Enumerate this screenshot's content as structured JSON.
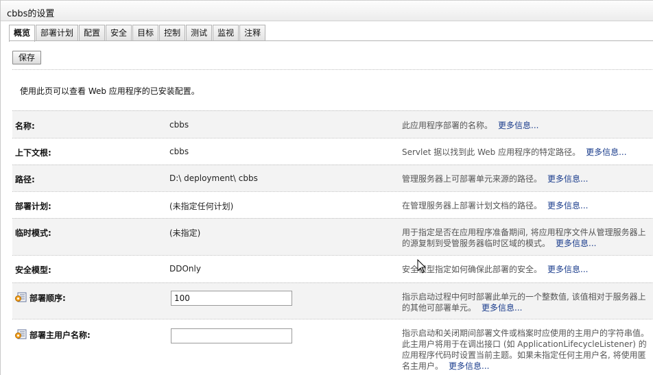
{
  "window": {
    "title": "cbbs的设置"
  },
  "tabs": [
    {
      "label": "概览",
      "active": true
    },
    {
      "label": "部署计划"
    },
    {
      "label": "配置"
    },
    {
      "label": "安全"
    },
    {
      "label": "目标"
    },
    {
      "label": "控制"
    },
    {
      "label": "测试"
    },
    {
      "label": "监视"
    },
    {
      "label": "注释"
    }
  ],
  "toolbar": {
    "save_label": "保存"
  },
  "intro": "使用此页可以查看 Web 应用程序的已安装配置。",
  "more_info": "更多信息...",
  "rows": [
    {
      "label": "名称:",
      "value": "cbbs",
      "desc": "此应用程序部署的名称。"
    },
    {
      "label": "上下文根:",
      "value": "cbbs",
      "desc": "Servlet 据以找到此 Web 应用程序的特定路径。"
    },
    {
      "label": "路径:",
      "value": "D:\\ deployment\\ cbbs",
      "desc": "管理服务器上可部署单元来源的路径。"
    },
    {
      "label": "部署计划:",
      "value": "(未指定任何计划)",
      "desc": "在管理服务器上部署计划文档的路径。"
    },
    {
      "label": "临时模式:",
      "value": "(未指定)",
      "desc": "用于指定是否在应用程序准备期间, 将应用程序文件从管理服务器上的源复制到受管服务器临时区域的模式。"
    },
    {
      "label": "安全模型:",
      "value": "DDOnly",
      "desc": "安全模型指定如何确保此部署的安全。"
    },
    {
      "label": "部署顺序:",
      "value": "100",
      "desc": "指示启动过程中何时部署此单元的一个整数值, 该值相对于服务器上的其他可部署单元。"
    },
    {
      "label": "部署主用户名称:",
      "value": "",
      "desc": "指示启动和关闭期间部署文件或档案时应使用的主用户的字符串值。此主用户将用于在调出接口 (如 ApplicationLifecycleListener) 的应用程序代码时设置当前主题。如果未指定任何主用户名, 将使用匿名主用户。"
    }
  ],
  "colors": {
    "link": "#1a3c8c",
    "row_shade": "#f3f3f3",
    "desc_text": "#555555"
  },
  "icons": {
    "config_row": "config-edit-icon",
    "pointer": "mouse-cursor-icon"
  }
}
